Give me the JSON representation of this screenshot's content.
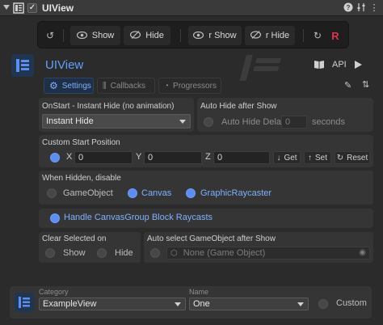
{
  "header": {
    "title": "UIView",
    "help_icon": "help-icon",
    "settings_icon": "sliders-icon",
    "menu_icon": "kebab-icon"
  },
  "toolbar": {
    "reset_icon": "undo-icon",
    "show_label": "Show",
    "hide_label": "Hide",
    "reverse_show_label": "r Show",
    "reverse_hide_label": "r Hide",
    "refresh_icon": "refresh-icon",
    "brand_icon": "r-logo-icon"
  },
  "component": {
    "title": "UIView",
    "api_label": "API"
  },
  "tabs": [
    {
      "label": "Settings"
    },
    {
      "label": "Callbacks"
    },
    {
      "label": "Progressors"
    }
  ],
  "on_start": {
    "label": "OnStart - Instant Hide (no animation)",
    "value": "Instant Hide"
  },
  "auto_hide": {
    "label": "Auto Hide after Show",
    "delay_label": "Auto Hide Delay",
    "delay_value": "0",
    "unit": "seconds"
  },
  "custom_start": {
    "label": "Custom Start Position",
    "x_label": "X",
    "x_value": "0",
    "y_label": "Y",
    "y_value": "0",
    "z_label": "Z",
    "z_value": "0",
    "get_label": "Get",
    "set_label": "Set",
    "reset_label": "Reset"
  },
  "when_hidden": {
    "label": "When Hidden, disable",
    "options": [
      {
        "label": "GameObject",
        "on": false
      },
      {
        "label": "Canvas",
        "on": true
      },
      {
        "label": "GraphicRaycaster",
        "on": true
      }
    ]
  },
  "handle_raycast": {
    "label": "Handle CanvasGroup Block Raycasts",
    "on": true
  },
  "clear_selected": {
    "label": "Clear Selected on",
    "show_label": "Show",
    "hide_label": "Hide"
  },
  "auto_select": {
    "label": "Auto select GameObject after Show",
    "value": "None (Game Object)"
  },
  "id": {
    "category_label": "Category",
    "category_value": "ExampleView",
    "name_label": "Name",
    "name_value": "One",
    "custom_label": "Custom"
  },
  "colors": {
    "accent": "#5e8df0",
    "accent_text": "#7fb0ff",
    "brand": "#e0324b"
  }
}
